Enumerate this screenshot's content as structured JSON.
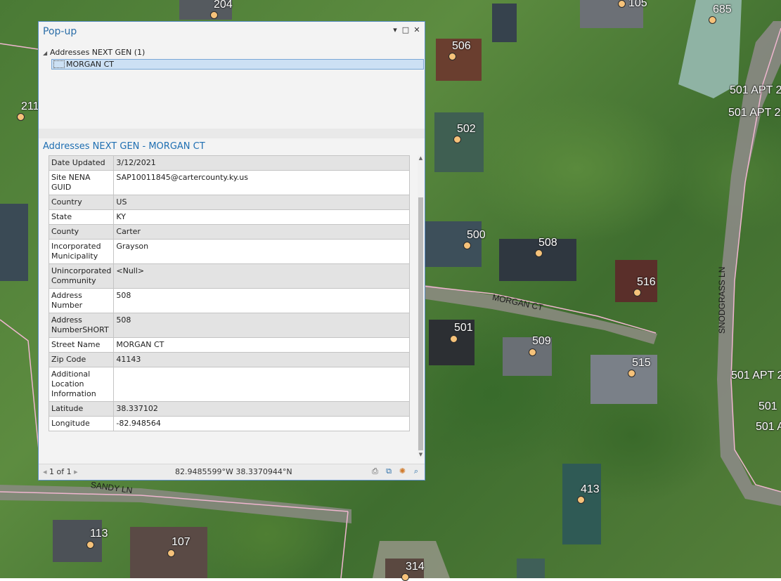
{
  "map": {
    "address_points": [
      {
        "label": "204"
      },
      {
        "label": "105"
      },
      {
        "label": "685"
      },
      {
        "label": "506"
      },
      {
        "label": "211"
      },
      {
        "label": "502"
      },
      {
        "label": "501 APT 2"
      },
      {
        "label": "501 APT 2"
      },
      {
        "label": "500"
      },
      {
        "label": "508"
      },
      {
        "label": "516"
      },
      {
        "label": "501"
      },
      {
        "label": "509"
      },
      {
        "label": "515"
      },
      {
        "label": "501 APT 2"
      },
      {
        "label": "501"
      },
      {
        "label": "501 A"
      },
      {
        "label": "413"
      },
      {
        "label": "113"
      },
      {
        "label": "107"
      },
      {
        "label": "314"
      }
    ],
    "road_labels": {
      "morgan_ct": "MORGAN CT",
      "snodgrass_ln": "SNODGRASS LN",
      "sandy_ln": "SANDY LN"
    },
    "colors": {
      "point_fill": "#f6c27a",
      "road_line": "#f0b6d0"
    }
  },
  "popup": {
    "title": "Pop-up",
    "controls": {
      "menu": "▾",
      "maximize": "□",
      "close": "✕"
    },
    "tree": {
      "layer_label": "Addresses NEXT GEN  (1)",
      "feature_label": "MORGAN CT"
    },
    "detail_title": "Addresses NEXT GEN -  MORGAN CT",
    "attributes": [
      {
        "key": "Date Updated",
        "value": "3/12/2021"
      },
      {
        "key": "Site NENA GUID",
        "value": "SAP10011845@cartercounty.ky.us"
      },
      {
        "key": "Country",
        "value": "US"
      },
      {
        "key": "State",
        "value": "KY"
      },
      {
        "key": "County",
        "value": "Carter"
      },
      {
        "key": "Incorporated Municipality",
        "value": "Grayson"
      },
      {
        "key": "Unincorporated Community",
        "value": "<Null>"
      },
      {
        "key": "Address Number",
        "value": "508"
      },
      {
        "key": "Address NumberSHORT",
        "value": "508"
      },
      {
        "key": "Street Name",
        "value": "MORGAN CT"
      },
      {
        "key": "Zip Code",
        "value": "41143"
      },
      {
        "key": "Additional Location Information",
        "value": ""
      },
      {
        "key": "Latitude",
        "value": "38.337102"
      },
      {
        "key": "Longitude",
        "value": "-82.948564"
      }
    ],
    "footer": {
      "pager": "1 of 1",
      "coordinates": "82.9485599°W 38.3370944°N"
    }
  }
}
